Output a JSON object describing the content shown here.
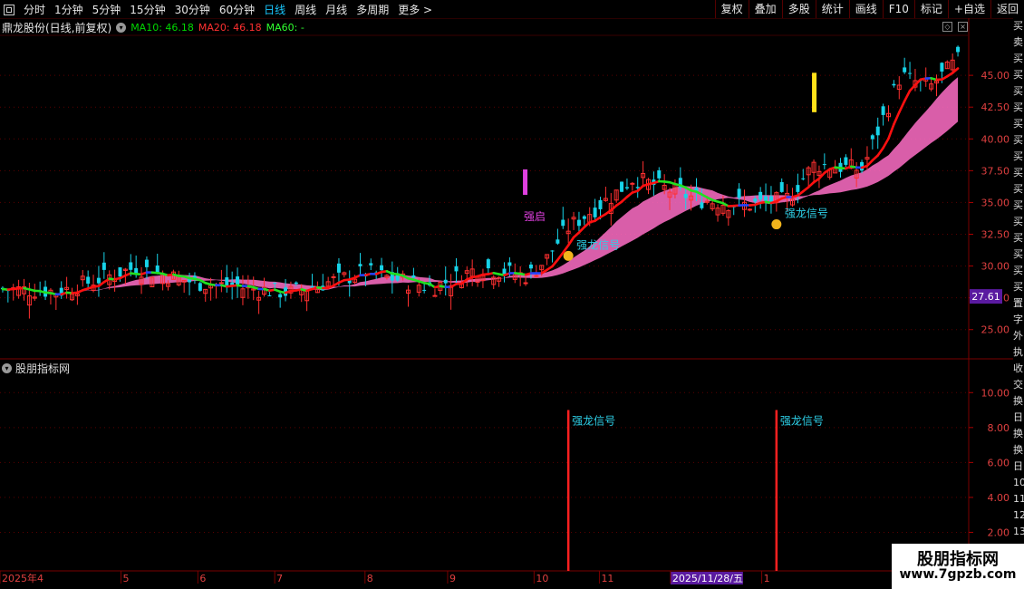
{
  "toolbar": {
    "periods": [
      "分时",
      "1分钟",
      "5分钟",
      "15分钟",
      "30分钟",
      "60分钟",
      "日线",
      "周线",
      "月线",
      "多周期",
      "更多 >"
    ],
    "active_period": "日线",
    "actions": [
      "复权",
      "叠加",
      "多股",
      "统计",
      "画线",
      "F10",
      "标记",
      "+自选",
      "返回"
    ]
  },
  "chart_header": {
    "stock": "鼎龙股份(日线,前复权)",
    "ma10": "MA10: 46.18",
    "ma20": "MA20: 46.18",
    "ma60": "MA60: -"
  },
  "price_axis": {
    "labels": [
      "45.00",
      "42.50",
      "40.00",
      "37.50",
      "35.00",
      "32.50",
      "30.00",
      "27.50",
      "25.00"
    ],
    "current_price": "27.61"
  },
  "annotations": {
    "signal_label": "强龙信号",
    "start_label": "强启"
  },
  "indicator": {
    "title": "股朋指标网",
    "axis_labels": [
      "10.00",
      "8.00",
      "6.00",
      "4.00",
      "2.00"
    ]
  },
  "x_axis": {
    "labels": [
      "2025年4",
      "5",
      "6",
      "7",
      "8",
      "9",
      "10",
      "11",
      "2025/11/28/五",
      "1"
    ]
  },
  "right_sidebar": {
    "chars": [
      "买",
      "卖",
      "买",
      "买",
      "买",
      "买",
      "买",
      "买",
      "买",
      "买",
      "买",
      "买",
      "买",
      "买",
      "买",
      "买",
      "买",
      "置",
      "字",
      "外",
      "执",
      "收",
      "交",
      "换",
      "日",
      "换",
      "换",
      "日",
      "10",
      "11",
      "12",
      "13",
      "14",
      "15"
    ]
  },
  "watermark": {
    "line1": "股朋指标网",
    "line2": "www.7gpzb.com"
  },
  "colors": {
    "up": "#ff3030",
    "down": "#17d3e8",
    "ma_up": "#ff1010",
    "ma_down": "#22e022",
    "ma_flat": "#2244ff",
    "band": "#ff6ec7",
    "signal": "#2ed0e8",
    "accent": "#19c8ff"
  },
  "chart_data": {
    "type": "candlestick",
    "title": "",
    "ylim": [
      22.7,
      49.5
    ],
    "y_ticks": [
      45.0,
      42.5,
      40.0,
      37.5,
      35.0,
      32.5,
      30.0,
      27.5,
      25.0
    ],
    "x_labels": [
      "2025年4",
      "5",
      "6",
      "7",
      "8",
      "9",
      "10",
      "11",
      "2025/11/28/五",
      "1"
    ],
    "close_trend": [
      {
        "date": "2025-04",
        "close": 28.2
      },
      {
        "date": "2025-04-end",
        "close": 29.5
      },
      {
        "date": "2025-05",
        "close": 29.9
      },
      {
        "date": "2025-06",
        "close": 28.0
      },
      {
        "date": "2025-07",
        "close": 28.5
      },
      {
        "date": "2025-08",
        "close": 28.6
      },
      {
        "date": "2025-09",
        "close": 31.2
      },
      {
        "date": "2025-10",
        "close": 36.8
      },
      {
        "date": "2025-11",
        "close": 35.0
      },
      {
        "date": "2025-11-28",
        "close": 37.5
      },
      {
        "date": "2025-12",
        "close": 46.5
      },
      {
        "date": "2026-01",
        "close": 46.2
      }
    ],
    "indicator": {
      "name": "强龙信号",
      "ylim": [
        0,
        11
      ],
      "signals": [
        {
          "date": "2025-10",
          "value": 9
        },
        {
          "date": "2025-11-28",
          "value": 9
        }
      ]
    }
  }
}
